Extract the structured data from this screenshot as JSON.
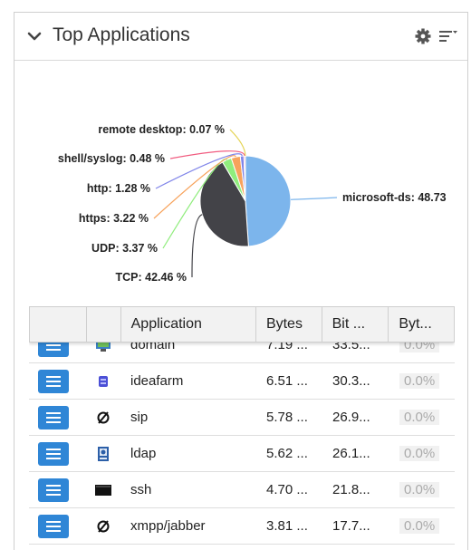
{
  "widget": {
    "title": "Top Applications"
  },
  "chart_data": {
    "type": "pie",
    "slices": [
      {
        "label": "microsoft-ds",
        "value": 48.73,
        "display": "microsoft-ds: 48.73",
        "color": "#7cb5ec"
      },
      {
        "label": "TCP",
        "value": 42.46,
        "display": "TCP: 42.46 %",
        "color": "#434348"
      },
      {
        "label": "UDP",
        "value": 3.37,
        "display": "UDP: 3.37 %",
        "color": "#90ed7d"
      },
      {
        "label": "https",
        "value": 3.22,
        "display": "https: 3.22 %",
        "color": "#f7a35c"
      },
      {
        "label": "http",
        "value": 1.28,
        "display": "http: 1.28 %",
        "color": "#8085e9"
      },
      {
        "label": "shell/syslog",
        "value": 0.48,
        "display": "shell/syslog: 0.48 %",
        "color": "#f15c80"
      },
      {
        "label": "remote desktop",
        "value": 0.07,
        "display": "remote desktop: 0.07 %",
        "color": "#e4d354"
      }
    ]
  },
  "table": {
    "headers": [
      "",
      "",
      "Application",
      "Bytes",
      "Bit ...",
      "Byt..."
    ],
    "rows": [
      {
        "icon": "domain-icon",
        "app": "domain",
        "bytes": "7.19 ...",
        "bits": "33.5...",
        "pct": "0.0%"
      },
      {
        "icon": "ideafarm-icon",
        "app": "ideafarm",
        "bytes": "6.51 ...",
        "bits": "30.3...",
        "pct": "0.0%"
      },
      {
        "icon": "null-icon",
        "app": "sip",
        "bytes": "5.78 ...",
        "bits": "26.9...",
        "pct": "0.0%"
      },
      {
        "icon": "ldap-icon",
        "app": "ldap",
        "bytes": "5.62 ...",
        "bits": "26.1...",
        "pct": "0.0%"
      },
      {
        "icon": "terminal-icon",
        "app": "ssh",
        "bytes": "4.70 ...",
        "bits": "21.8...",
        "pct": "0.0%"
      },
      {
        "icon": "null-icon",
        "app": "xmpp/jabber",
        "bytes": "3.81 ...",
        "bits": "17.7...",
        "pct": "0.0%"
      }
    ]
  }
}
